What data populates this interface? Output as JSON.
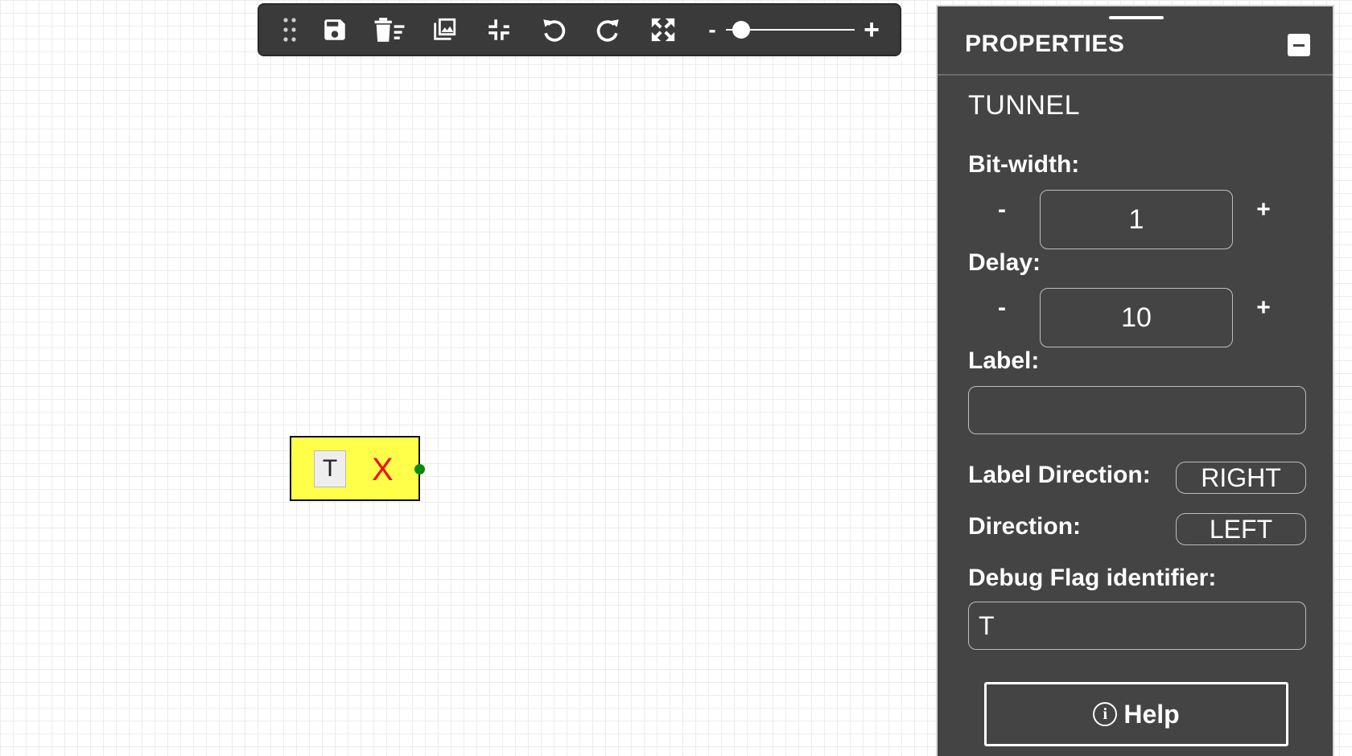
{
  "toolbar": {
    "buttons": [
      {
        "icon": "drag-dots-icon"
      },
      {
        "icon": "save-icon"
      },
      {
        "icon": "delete-all-icon"
      },
      {
        "icon": "image-icon"
      },
      {
        "icon": "fit-screen-icon"
      },
      {
        "icon": "undo-icon"
      },
      {
        "icon": "redo-icon"
      },
      {
        "icon": "fullscreen-icon"
      }
    ],
    "zoom": {
      "minus_label": "-",
      "plus_label": "+",
      "level": 0.12
    }
  },
  "canvas": {
    "element": {
      "inner_label": "T",
      "value_label": "X"
    }
  },
  "properties": {
    "title": "PROPERTIES",
    "element_name": "TUNNEL",
    "bit_width": {
      "label": "Bit-width:",
      "value": "1",
      "decrement": "-",
      "increment": "+"
    },
    "delay": {
      "label": "Delay:",
      "value": "10",
      "decrement": "-",
      "increment": "+"
    },
    "label_field": {
      "label": "Label:",
      "value": ""
    },
    "label_direction": {
      "label": "Label Direction:",
      "value": "RIGHT"
    },
    "direction": {
      "label": "Direction:",
      "value": "LEFT"
    },
    "debug_flag": {
      "label": "Debug Flag identifier:",
      "value": "T"
    },
    "help_label": "Help",
    "help_icon_glyph": "i"
  }
}
